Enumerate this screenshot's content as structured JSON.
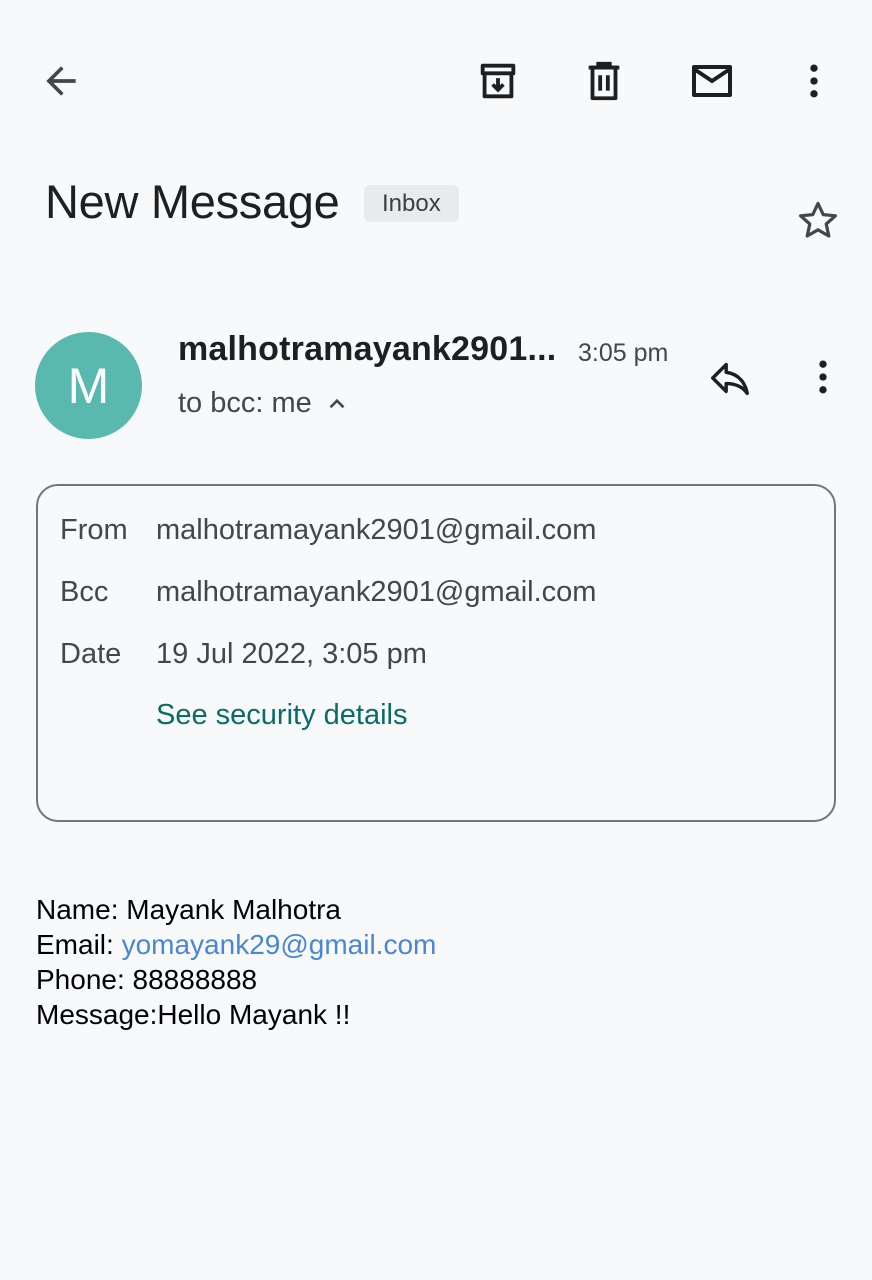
{
  "toolbar": {
    "back_icon": "arrow-left-icon",
    "archive_icon": "archive-icon",
    "delete_icon": "trash-icon",
    "mark_unread_icon": "mail-icon",
    "more_icon": "more-vert-icon"
  },
  "message": {
    "subject": "New Message",
    "label": "Inbox"
  },
  "sender": {
    "avatar_letter": "M",
    "avatar_color": "#5ab9ae",
    "name": "malhotramayank2901...",
    "time": "3:05 pm",
    "recipients": "to bcc: me"
  },
  "details": {
    "from_label": "From",
    "from_value": "malhotramayank2901@gmail.com",
    "bcc_label": "Bcc",
    "bcc_value": "malhotramayank2901@gmail.com",
    "date_label": "Date",
    "date_value": "19 Jul 2022, 3:05 pm",
    "security_link": "See security details"
  },
  "body": {
    "name_line": "Name: Mayank Malhotra",
    "email_prefix": "Email: ",
    "email_link": "yomayank29@gmail.com",
    "phone_line": "Phone: 88888888",
    "message_line": "Message:Hello Mayank !!"
  }
}
